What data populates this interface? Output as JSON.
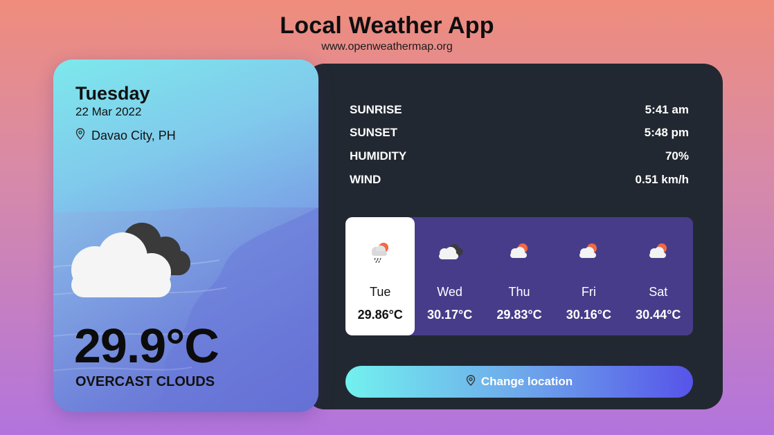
{
  "header": {
    "title": "Local Weather App",
    "subtitle": "www.openweathermap.org"
  },
  "current": {
    "day": "Tuesday",
    "date": "22 Mar 2022",
    "location": "Davao City, PH",
    "temperature": "29.9°C",
    "condition": "OVERCAST CLOUDS",
    "icon": "overcast-clouds-icon"
  },
  "stats": [
    {
      "label": "SUNRISE",
      "value": "5:41 am"
    },
    {
      "label": "SUNSET",
      "value": "5:48 pm"
    },
    {
      "label": "HUMIDITY",
      "value": "70%"
    },
    {
      "label": "WIND",
      "value": "0.51 km/h"
    }
  ],
  "forecast": [
    {
      "day": "Tue",
      "temp": "29.86°C",
      "icon": "rain-sun-cloud-icon",
      "active": true
    },
    {
      "day": "Wed",
      "temp": "30.17°C",
      "icon": "overcast-clouds-icon",
      "active": false
    },
    {
      "day": "Thu",
      "temp": "29.83°C",
      "icon": "sun-behind-cloud-icon",
      "active": false
    },
    {
      "day": "Fri",
      "temp": "30.16°C",
      "icon": "sun-behind-cloud-icon",
      "active": false
    },
    {
      "day": "Sat",
      "temp": "30.44°C",
      "icon": "sun-behind-cloud-icon",
      "active": false
    }
  ],
  "button": {
    "label": "Change location"
  },
  "colors": {
    "panel_dark": "#222831",
    "forecast_bg": "#473c8a",
    "button_gradient_start": "#72f1ef",
    "button_gradient_end": "#5654e9"
  }
}
